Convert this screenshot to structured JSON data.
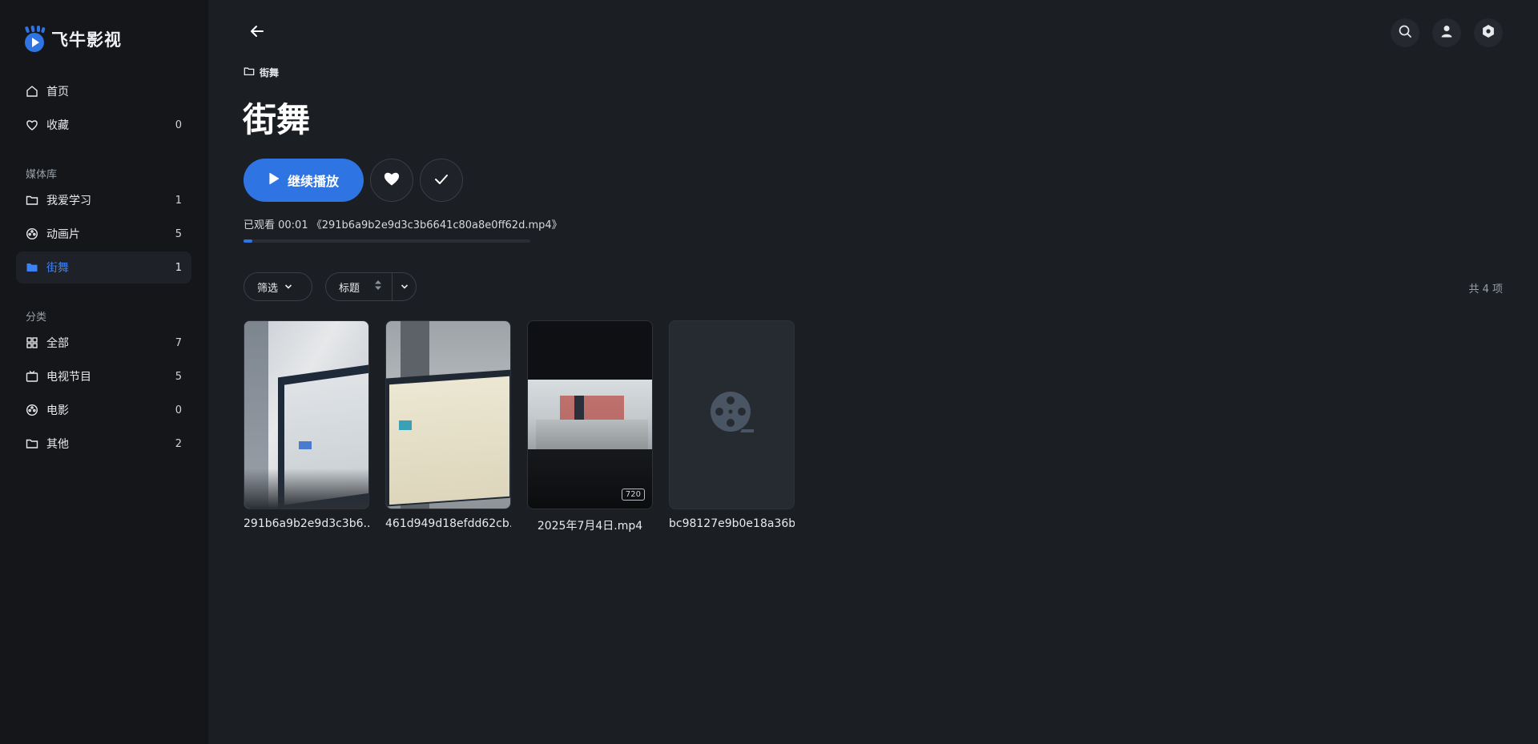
{
  "app": {
    "name": "飞牛影视"
  },
  "sidebar": {
    "top_items": [
      {
        "label": "首页",
        "count": ""
      },
      {
        "label": "收藏",
        "count": "0"
      }
    ],
    "library_title": "媒体库",
    "library_items": [
      {
        "label": "我爱学习",
        "count": "1"
      },
      {
        "label": "动画片",
        "count": "5"
      },
      {
        "label": "街舞",
        "count": "1"
      }
    ],
    "category_title": "分类",
    "category_items": [
      {
        "label": "全部",
        "count": "7"
      },
      {
        "label": "电视节目",
        "count": "5"
      },
      {
        "label": "电影",
        "count": "0"
      },
      {
        "label": "其他",
        "count": "2"
      }
    ]
  },
  "header": {
    "breadcrumb": "街舞",
    "title": "街舞"
  },
  "actions": {
    "play_label": "继续播放"
  },
  "progress": {
    "watched_text": "已观看 00:01 《291b6a9b2e9d3c3b6641c80a8e0ff62d.mp4》",
    "fraction": 0.03
  },
  "toolbar": {
    "filter_label": "筛选",
    "sort_label": "标题",
    "total_text": "共 4 项"
  },
  "items": [
    {
      "caption": "291b6a9b2e9d3c3b6..."
    },
    {
      "caption": "461d949d18efdd62cb..."
    },
    {
      "caption": "2025年7月4日.mp4",
      "badge": "720"
    },
    {
      "caption": "bc98127e9b0e18a36b..."
    }
  ],
  "colors": {
    "accent": "#2f74e3",
    "background": "#1b1e23",
    "sidebar": "#141619"
  }
}
